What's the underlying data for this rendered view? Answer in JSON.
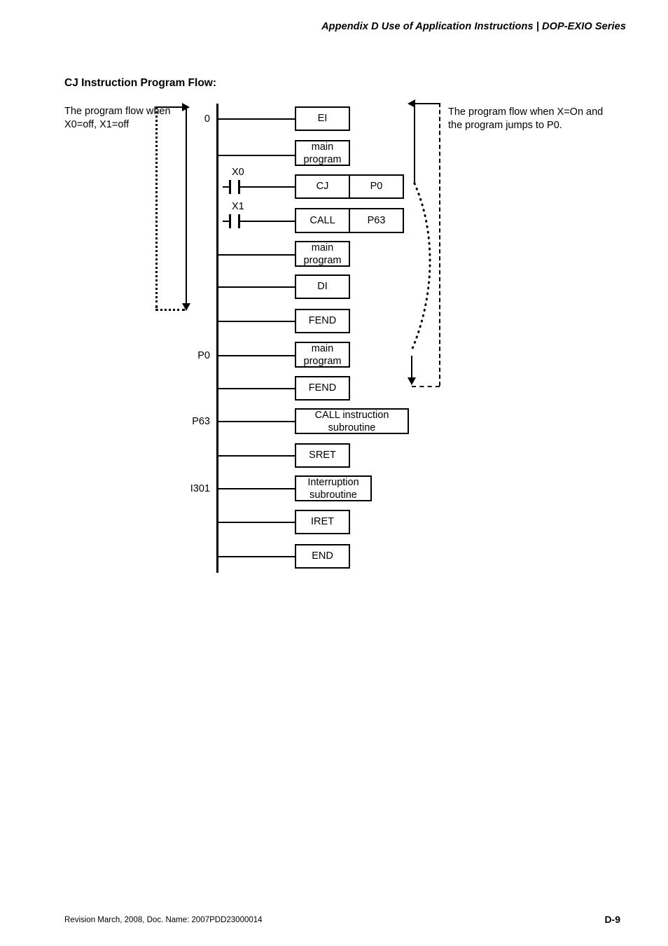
{
  "header": {
    "title": "Appendix D Use of Application Instructions | DOP-EXIO Series"
  },
  "section": {
    "title": "CJ Instruction Program Flow:"
  },
  "annotations": {
    "left": "The program flow when X0=off, X1=off",
    "right": "The program flow when X=On and the program jumps to P0."
  },
  "ladder": {
    "rows": [
      {
        "label": "0",
        "contact": "",
        "box": "EI",
        "operand": "",
        "kind": "single"
      },
      {
        "label": "",
        "contact": "",
        "box": "main\nprogram",
        "operand": "",
        "kind": "single"
      },
      {
        "label": "",
        "contact": "X0",
        "box": "CJ",
        "operand": "P0",
        "kind": "two"
      },
      {
        "label": "",
        "contact": "X1",
        "box": "CALL",
        "operand": "P63",
        "kind": "two"
      },
      {
        "label": "",
        "contact": "",
        "box": "main\nprogram",
        "operand": "",
        "kind": "single"
      },
      {
        "label": "",
        "contact": "",
        "box": "DI",
        "operand": "",
        "kind": "single"
      },
      {
        "label": "",
        "contact": "",
        "box": "FEND",
        "operand": "",
        "kind": "single"
      },
      {
        "label": "P0",
        "contact": "",
        "box": "main\nprogram",
        "operand": "",
        "kind": "single"
      },
      {
        "label": "",
        "contact": "",
        "box": "FEND",
        "operand": "",
        "kind": "single"
      },
      {
        "label": "P63",
        "contact": "",
        "box": "CALL instruction\nsubroutine",
        "operand": "",
        "kind": "wide"
      },
      {
        "label": "",
        "contact": "",
        "box": "SRET",
        "operand": "",
        "kind": "single"
      },
      {
        "label": "I301",
        "contact": "",
        "box": "Interruption\nsubroutine",
        "operand": "",
        "kind": "mid"
      },
      {
        "label": "",
        "contact": "",
        "box": "IRET",
        "operand": "",
        "kind": "single"
      },
      {
        "label": "",
        "contact": "",
        "box": "END",
        "operand": "",
        "kind": "single"
      }
    ]
  },
  "footer": {
    "revision": "Revision March, 2008, Doc. Name: 2007PDD23000014",
    "page": "D-9"
  }
}
